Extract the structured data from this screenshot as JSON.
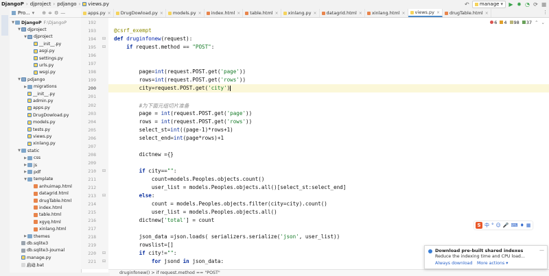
{
  "titlebar": {
    "breadcrumbs": [
      "DjangoP",
      "djproject",
      "pdjango",
      "views.py"
    ],
    "run_config": "manage",
    "colors": {
      "accent": "#4a88c7",
      "run": "#3aa24a"
    }
  },
  "project_panel": {
    "title": "Pro...",
    "root": {
      "label": "DjangoP",
      "path": "F:\\DjangoP"
    },
    "tree": [
      {
        "label": "djproject",
        "depth": 1,
        "kind": "pyfolder",
        "expanded": true
      },
      {
        "label": "djproject",
        "depth": 2,
        "kind": "pyfolder",
        "expanded": true
      },
      {
        "label": "__init__.py",
        "depth": 3,
        "kind": "py"
      },
      {
        "label": "asgi.py",
        "depth": 3,
        "kind": "py"
      },
      {
        "label": "settings.py",
        "depth": 3,
        "kind": "py"
      },
      {
        "label": "urls.py",
        "depth": 3,
        "kind": "py"
      },
      {
        "label": "wsgi.py",
        "depth": 3,
        "kind": "py"
      },
      {
        "label": "pdjango",
        "depth": 1,
        "kind": "pyfolder",
        "expanded": true
      },
      {
        "label": "migrations",
        "depth": 2,
        "kind": "folder",
        "expanded": false
      },
      {
        "label": "__init__.py",
        "depth": 2,
        "kind": "py"
      },
      {
        "label": "admin.py",
        "depth": 2,
        "kind": "py"
      },
      {
        "label": "apps.py",
        "depth": 2,
        "kind": "py"
      },
      {
        "label": "DrugDowload.py",
        "depth": 2,
        "kind": "py"
      },
      {
        "label": "models.py",
        "depth": 2,
        "kind": "py"
      },
      {
        "label": "tests.py",
        "depth": 2,
        "kind": "py"
      },
      {
        "label": "views.py",
        "depth": 2,
        "kind": "py"
      },
      {
        "label": "xinlang.py",
        "depth": 2,
        "kind": "py"
      },
      {
        "label": "static",
        "depth": 1,
        "kind": "folder",
        "expanded": true
      },
      {
        "label": "css",
        "depth": 2,
        "kind": "folder",
        "expanded": false
      },
      {
        "label": "js",
        "depth": 2,
        "kind": "folder",
        "expanded": false
      },
      {
        "label": "pdf",
        "depth": 2,
        "kind": "folder",
        "expanded": false
      },
      {
        "label": "template",
        "depth": 2,
        "kind": "folder",
        "expanded": true
      },
      {
        "label": "anhuimap.html",
        "depth": 3,
        "kind": "html"
      },
      {
        "label": "datagrid.html",
        "depth": 3,
        "kind": "html"
      },
      {
        "label": "drugTable.html",
        "depth": 3,
        "kind": "html"
      },
      {
        "label": "index.html",
        "depth": 3,
        "kind": "html"
      },
      {
        "label": "table.html",
        "depth": 3,
        "kind": "html"
      },
      {
        "label": "xgyq.html",
        "depth": 3,
        "kind": "html"
      },
      {
        "label": "xinlang.html",
        "depth": 3,
        "kind": "html"
      },
      {
        "label": "themes",
        "depth": 2,
        "kind": "folder",
        "expanded": false
      },
      {
        "label": "db.sqlite3",
        "depth": 1,
        "kind": "db"
      },
      {
        "label": "db.sqlite3-journal",
        "depth": 1,
        "kind": "db"
      },
      {
        "label": "manage.py",
        "depth": 1,
        "kind": "py"
      },
      {
        "label": "启动.bat",
        "depth": 1,
        "kind": "txt"
      }
    ]
  },
  "tabs": [
    {
      "label": "apps.py",
      "kind": "py"
    },
    {
      "label": "DrugDowload.py",
      "kind": "py"
    },
    {
      "label": "models.py",
      "kind": "py"
    },
    {
      "label": "index.html",
      "kind": "html"
    },
    {
      "label": "table.html",
      "kind": "html"
    },
    {
      "label": "xinlang.py",
      "kind": "py"
    },
    {
      "label": "datagrid.html",
      "kind": "html"
    },
    {
      "label": "xinlang.html",
      "kind": "html"
    },
    {
      "label": "views.py",
      "kind": "py",
      "active": true
    },
    {
      "label": "drugTable.html",
      "kind": "html"
    }
  ],
  "inspections": {
    "errors": "6",
    "warnings": "4",
    "weak": "98",
    "typos": "37"
  },
  "editor": {
    "current_line": 200,
    "lines": [
      {
        "n": "192",
        "t": ""
      },
      {
        "n": "193",
        "t": "@csrf_exempt"
      },
      {
        "n": "194",
        "t": "def druginfonew(request):"
      },
      {
        "n": "195",
        "t": "    if request.method == \"POST\":"
      },
      {
        "n": "196",
        "t": ""
      },
      {
        "n": "197",
        "t": ""
      },
      {
        "n": "198",
        "t": "        page=int(request.POST.get('page'))"
      },
      {
        "n": "199",
        "t": "        rows=int(request.POST.get('rows'))"
      },
      {
        "n": "200",
        "t": "        city=request.POST.get('city')"
      },
      {
        "n": "201",
        "t": ""
      },
      {
        "n": "202",
        "t": "        #为下面元组切片准备"
      },
      {
        "n": "203",
        "t": "        page = int(request.POST.get('page'))"
      },
      {
        "n": "204",
        "t": "        rows = int(request.POST.get('rows'))"
      },
      {
        "n": "205",
        "t": "        select_st=int((page-1)*rows+1)"
      },
      {
        "n": "206",
        "t": "        select_end=int(page*rows)+1"
      },
      {
        "n": "207",
        "t": ""
      },
      {
        "n": "208",
        "t": "        dictnew ={}"
      },
      {
        "n": "209",
        "t": ""
      },
      {
        "n": "210",
        "t": "        if city==\"\":"
      },
      {
        "n": "211",
        "t": "            count=models.Peoples.objects.count()"
      },
      {
        "n": "212",
        "t": "            user_list = models.Peoples.objects.all()[select_st:select_end]"
      },
      {
        "n": "213",
        "t": "        else:"
      },
      {
        "n": "214",
        "t": "            count = models.Peoples.objects.filter(city=city).count()"
      },
      {
        "n": "215",
        "t": "            user_list = models.Peoples.objects.all()"
      },
      {
        "n": "216",
        "t": "        dictnew['total'] = count"
      },
      {
        "n": "217",
        "t": ""
      },
      {
        "n": "218",
        "t": "        json_data =json.loads( serializers.serialize('json', user_list))"
      },
      {
        "n": "219",
        "t": "        rowslist=[]"
      },
      {
        "n": "220",
        "t": "        if city!=\"\":"
      },
      {
        "n": "221",
        "t": "            for jsond in json_data:"
      }
    ]
  },
  "breadcrumb_bar": "druginfonew()  >  if request.method == \"POST\"",
  "ime_toolbar": {
    "logo": "S",
    "items": [
      "中",
      "°",
      "☺",
      "🎤",
      "⌨",
      "♦",
      "▦"
    ]
  },
  "notification": {
    "title": "Download pre-built shared indexes",
    "body": "Reduce the indexing time and CPU load...",
    "action_primary": "Always download",
    "action_secondary": "More actions ▾"
  }
}
